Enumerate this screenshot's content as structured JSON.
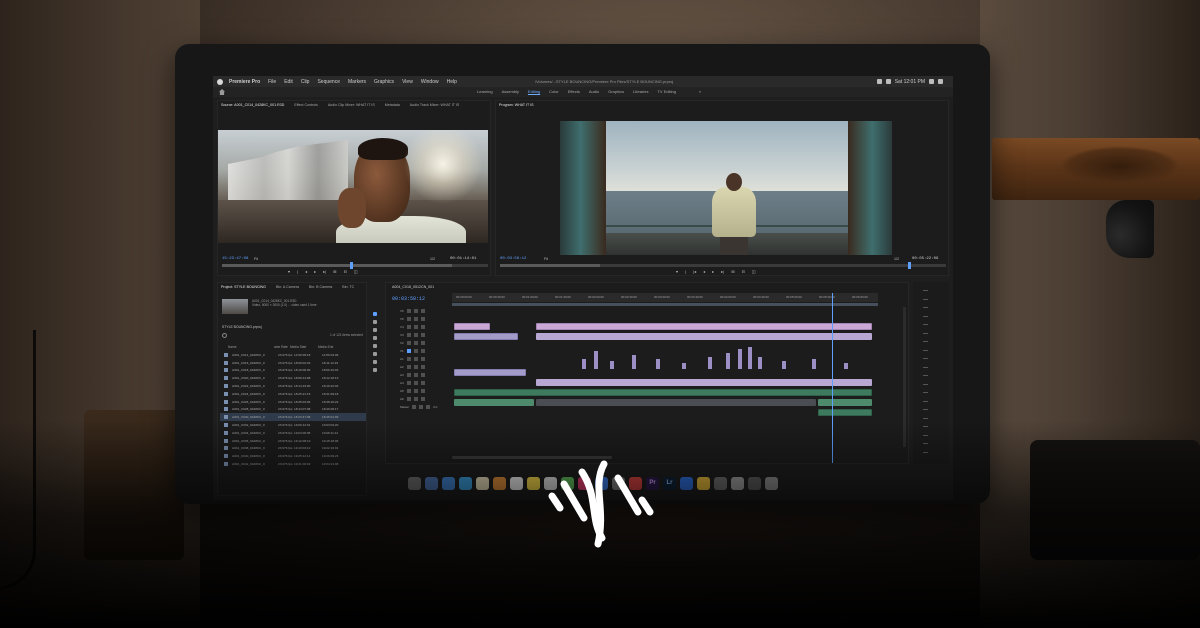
{
  "menubar": {
    "app": "Premiere Pro",
    "items": [
      "File",
      "Edit",
      "Clip",
      "Sequence",
      "Markers",
      "Graphics",
      "View",
      "Window",
      "Help"
    ],
    "file_path": "/Volumes/...STYLE BOUNCING/Premiere Pro Files/STYLE BOUNCING.prproj",
    "clock": "Sat 12:01 PM"
  },
  "workspaces": {
    "tabs": [
      "Learning",
      "Assembly",
      "Editing",
      "Color",
      "Effects",
      "Audio",
      "Graphics",
      "Libraries",
      "TV Editing"
    ],
    "active": "Editing",
    "more": "»"
  },
  "source_panel": {
    "tabs": [
      "Source: A001_C014_0428KC_001.R3D",
      "Effect Controls",
      "Audio Clip Mixer: WHAT IT IS",
      "Metadata",
      "Audio Track Mixer: WHAT IT IS"
    ],
    "timecode": "15:23:47:08",
    "fit": "Fit",
    "scale": "1/2",
    "duration": "00:01:14:01"
  },
  "program_panel": {
    "title": "Program: WHAT IT IS",
    "timecode": "00:03:58:12",
    "fit": "Fit",
    "scale": "1/2",
    "duration": "00:05:22:09"
  },
  "project_panel": {
    "tabs": [
      "Project: STYLE BOUNCING",
      "Bin: A Camera",
      "Bin: B Camera",
      "Bin: TC"
    ],
    "clip_name": "A001_C014_0428KC_001.R3D",
    "clip_meta": "Video, 5000 × 3000 (1.0) ... video used 1 time",
    "file": "STYLE BOUNCING.prproj",
    "count": "1 of 121 items selected",
    "columns": [
      "Name",
      "ame Rate",
      "Media Start",
      "Media End"
    ],
    "rows": [
      {
        "name": "A001_C014_0428KC_0",
        "rate": "23.976 fps",
        "start": "14:50:09:18",
        "end": "14:56:04:06"
      },
      {
        "name": "A001_C016_0428KC_0",
        "rate": "23.976 fps",
        "start": "18:09:02:03",
        "end": "18:11:12:19"
      },
      {
        "name": "A001_C018_0428KC_0",
        "rate": "23.976 fps",
        "start": "18:19:06:00",
        "end": "18:06:10:03"
      },
      {
        "name": "A001_C020_0428KC_0",
        "rate": "23.976 fps",
        "start": "18:09:14:08",
        "end": "18:12:18:13"
      },
      {
        "name": "A001_C022_0428KC_0",
        "rate": "23.976 fps",
        "start": "18:14:19:00",
        "end": "18:19:22:02"
      },
      {
        "name": "A001_C024_0428KC_0",
        "rate": "23.976 fps",
        "start": "18:25:21:15",
        "end": "18:31:09:18"
      },
      {
        "name": "A001_C026_0428KC_0",
        "rate": "23.976 fps",
        "start": "18:35:03:06",
        "end": "18:38:10:22"
      },
      {
        "name": "A001_C028_0428KC_0",
        "rate": "23.976 fps",
        "start": "18:44:07:08",
        "end": "18:46:00:17"
      },
      {
        "name": "A001_C030_0428KC_0",
        "rate": "23.976 fps",
        "start": "15:23:47:08",
        "end": "15:25:01:09"
      },
      {
        "name": "A001_C032_0428KC_0",
        "rate": "23.976 fps",
        "start": "19:00:12:01",
        "end": "19:03:04:20"
      },
      {
        "name": "A001_C034_0428KC_0",
        "rate": "23.976 fps",
        "start": "19:04:00:05",
        "end": "19:08:11:12"
      },
      {
        "name": "A001_C036_0428KC_0",
        "rate": "23.976 fps",
        "start": "19:12:08:19",
        "end": "19:15:18:06"
      },
      {
        "name": "A001_C038_0428KC_0",
        "rate": "23.976 fps",
        "start": "19:19:03:10",
        "end": "19:22:16:01"
      },
      {
        "name": "A001_C040_0428KC_0",
        "rate": "23.976 fps",
        "start": "19:25:12:14",
        "end": "19:29:09:23"
      },
      {
        "name": "A001_C042_0428KC_0",
        "rate": "23.976 fps",
        "start": "19:31:00:02",
        "end": "19:34:21:08"
      }
    ]
  },
  "timeline": {
    "tab": "A004_C018_0512CN_001",
    "timecode": "00:03:58:12",
    "ruler": [
      "00:00:00:00",
      "00:00:30:00",
      "00:01:00:00",
      "00:01:30:00",
      "00:02:00:00",
      "00:02:30:00",
      "00:03:00:00",
      "00:03:30:00",
      "00:04:00:00",
      "00:04:30:00",
      "00:05:00:00",
      "00:05:30:00",
      "00:06:00:00"
    ],
    "tracks": [
      "V6",
      "V5",
      "V4",
      "V3",
      "V2",
      "V1",
      "A1",
      "A2",
      "A3",
      "A4",
      "A5",
      "A6",
      "Master"
    ],
    "master_value": "0.0"
  },
  "dock": {
    "premiere_label": "Pr",
    "lightroom_label": "Lr"
  }
}
